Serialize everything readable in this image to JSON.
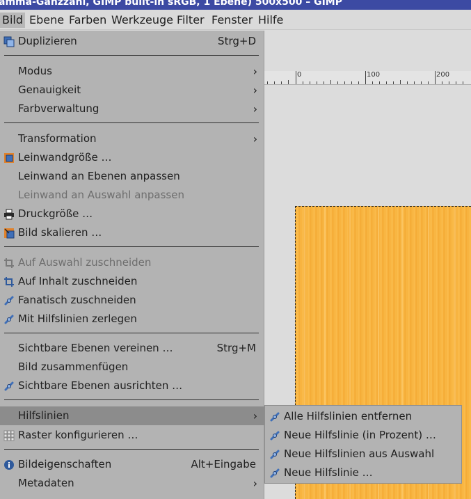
{
  "window": {
    "title": "amma-Ganzzahl, GIMP built-in sRGB, 1 Ebene) 500x500 – GIMP"
  },
  "menubar": {
    "items": [
      "Bild",
      "Ebene",
      "Farben",
      "Werkzeuge",
      "Filter",
      "Fenster",
      "Hilfe"
    ],
    "active": "Bild"
  },
  "ruler": {
    "labels": [
      "0",
      "100",
      "200"
    ]
  },
  "image_menu": {
    "duplicate": {
      "label": "Duplizieren",
      "shortcut": "Strg+D",
      "icon": "duplicate-icon"
    },
    "mode": {
      "label": "Modus"
    },
    "precision": {
      "label": "Genauigkeit"
    },
    "color_management": {
      "label": "Farbverwaltung"
    },
    "transform": {
      "label": "Transformation"
    },
    "canvas_size": {
      "label": "Leinwandgröße …",
      "icon": "canvas-size-icon"
    },
    "fit_canvas_layers": {
      "label": "Leinwand an Ebenen anpassen"
    },
    "fit_canvas_selection": {
      "label": "Leinwand an Auswahl anpassen"
    },
    "print_size": {
      "label": "Druckgröße …",
      "icon": "printer-icon"
    },
    "scale_image": {
      "label": "Bild skalieren …",
      "icon": "scale-icon"
    },
    "crop_selection": {
      "label": "Auf Auswahl zuschneiden",
      "icon": "crop-icon"
    },
    "crop_content": {
      "label": "Auf Inhalt zuschneiden",
      "icon": "crop-icon"
    },
    "zealous_crop": {
      "label": "Fanatisch zuschneiden",
      "icon": "plugin-icon"
    },
    "guillotine": {
      "label": "Mit Hilfslinien zerlegen",
      "icon": "plugin-icon"
    },
    "merge_visible": {
      "label": "Sichtbare Ebenen vereinen …",
      "shortcut": "Strg+M"
    },
    "flatten": {
      "label": "Bild zusammenfügen"
    },
    "align_visible": {
      "label": "Sichtbare Ebenen ausrichten …",
      "icon": "plugin-icon"
    },
    "guides": {
      "label": "Hilfslinien"
    },
    "grid": {
      "label": "Raster konfigurieren …",
      "icon": "grid-icon"
    },
    "properties": {
      "label": "Bildeigenschaften",
      "shortcut": "Alt+Eingabe",
      "icon": "info-icon"
    },
    "metadata": {
      "label": "Metadaten"
    }
  },
  "guides_submenu": {
    "items": [
      {
        "label": "Alle Hilfslinien entfernen",
        "icon": "plugin-icon"
      },
      {
        "label": "Neue Hilfslinie (in Prozent) …",
        "icon": "plugin-icon"
      },
      {
        "label": "Neue Hilfslinien aus Auswahl",
        "icon": "plugin-icon"
      },
      {
        "label": "Neue Hilfslinie …",
        "icon": "plugin-icon"
      }
    ]
  },
  "colors": {
    "menu_bg": "#b3b3b3",
    "highlight": "#8c8c8c",
    "titlebar": "#3c4aa3",
    "image_fill": "#f7b23d"
  }
}
